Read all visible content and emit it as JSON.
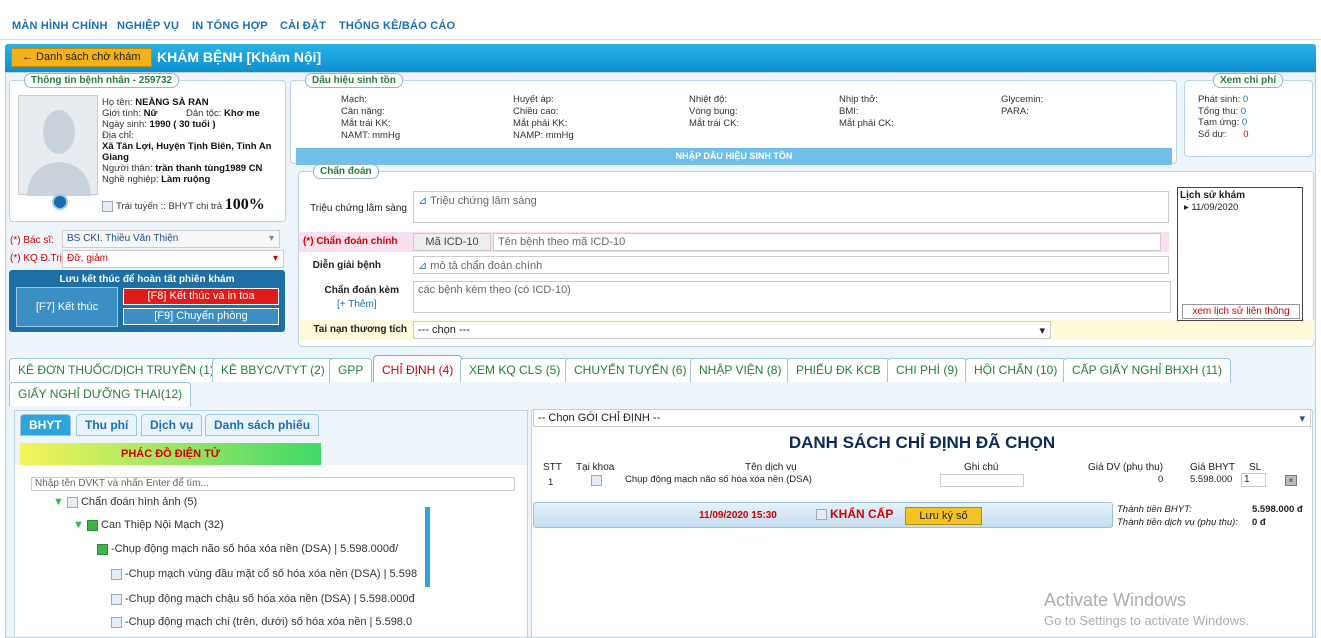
{
  "nav": [
    "MÀN HÌNH CHÍNH",
    "NGHIỆP VỤ",
    "IN TỔNG HỢP",
    "CÀI ĐẶT",
    "THỐNG KÊ/BÁO CÁO"
  ],
  "header": {
    "back": "← Danh sách chờ khám",
    "title": "KHÁM BỆNH [Khám Nội]"
  },
  "patient": {
    "legend": "Thông tin bệnh nhân - 259732",
    "name_label": "Họ tên:",
    "name": "NEÀNG SÀ RAN",
    "gender_label": "Giới tính:",
    "gender": "Nữ",
    "ethnic_label": "Dân tộc:",
    "ethnic": "Khơ me",
    "dob_label": "Ngày sinh:",
    "dob": "1990 ( 30 tuổi )",
    "addr_label": "Địa chỉ:",
    "addr1": "Xã Tân Lợi, Huyện Tịnh Biên, Tỉnh An",
    "addr2": "Giang",
    "rel_label": "Người thân:",
    "rel": "trần thanh tùng1989 CN",
    "job_label": "Nghề nghiệp:",
    "job": "Làm ruộng",
    "bhyt_text": "Trái tuyến :: BHYT chi trả",
    "bhyt_pct": "100%"
  },
  "vitals": {
    "legend": "Dấu hiệu sinh tồn",
    "c1": [
      "Mạch:",
      "Cân nặng:",
      "Mắt trái KK:",
      "NAMT:    mmHg"
    ],
    "c2": [
      "Huyết áp:",
      "Chiều cao:",
      "Mắt phải KK:",
      "NAMP:    mmHg"
    ],
    "c3": [
      "Nhiệt độ:",
      "Vòng bụng:",
      "Mắt trái CK:"
    ],
    "c4": [
      "Nhịp thở:",
      "BMI:",
      "Mắt phải CK:"
    ],
    "c5": [
      "Glycemin:",
      "PARA:"
    ],
    "button": "NHẬP DẤU HIỆU SINH TỒN"
  },
  "cost": {
    "legend": "Xem chi phí",
    "rows": [
      [
        "Phát sinh:",
        "0"
      ],
      [
        "Tổng thu:",
        "0"
      ],
      [
        "Tạm ứng:",
        "0"
      ],
      [
        "Số dư:",
        "0"
      ]
    ]
  },
  "doctor": {
    "label": "(*) Bác sĩ:",
    "value": "BS CKI. Thiều Văn Thiện",
    "kq_label": "(*) KQ Đ.Trị",
    "kq_value": "Đỡ, giảm"
  },
  "finish": {
    "title": "Lưu kết thúc để hoàn tất phiên khám",
    "f7": "[F7] Kết thúc",
    "f8": "[F8] Kết thúc và in toa",
    "f9": "[F9] Chuyển phòng"
  },
  "diag": {
    "legend": "Chẩn đoán",
    "symptom_label": "Triệu chứng lâm sàng",
    "symptom_ph": "Triệu chứng lâm sàng",
    "main_label": "(*) Chẩn đoán chính",
    "icd": "Mã ICD-10",
    "icd_name": "Tên bệnh theo mã ICD-10",
    "explain_label": "Diễn giải bệnh",
    "explain_ph": "mô tả chẩn đoán chính",
    "sub_label": "Chẩn đoán kèm",
    "add": "[+ Thêm]",
    "sub_ph": "các bệnh kèm theo (có ICD-10)",
    "acc_label": "Tai nạn thương tích",
    "acc_value": "--- chọn ---"
  },
  "history": {
    "title": "Lịch sử khám",
    "date": "11/09/2020",
    "link": "xem lịch sử liên thông"
  },
  "tabs": [
    "KÊ ĐƠN THUỐC/DỊCH TRUYỀN (1)",
    "KÊ BBYC/VTYT (2)",
    "GPP",
    "CHỈ ĐỊNH (4)",
    "XEM KQ CLS (5)",
    "CHUYỂN TUYẾN (6)",
    "NHẬP VIỆN (8)",
    "PHIẾU ĐK KCB",
    "CHI PHÍ (9)",
    "HỘI CHẨN (10)",
    "CẤP GIẤY NGHỈ BHXH (11)",
    "GIẤY NGHỈ DƯỠNG THAI(12)"
  ],
  "subtabs": [
    "BHYT",
    "Thu phí",
    "Dịch vụ",
    "Danh sách phiếu"
  ],
  "protocol": "PHÁC ĐỒ ĐIỆN TỬ",
  "search_ph": "Nhập tên DVKT và nhấn Enter để tìm...",
  "tree": {
    "root": "Chẩn đoán hình ảnh (5)",
    "group": "Can Thiệp Nội Mạch (32)",
    "items": [
      "-Chụp động mạch não số hóa xóa nền (DSA) | 5.598.000đ/",
      "-Chụp mạch vùng đầu mặt cổ số hóa xóa nền (DSA) | 5.598",
      "-Chụp động mạch chậu số hóa xóa nền (DSA) | 5.598.000đ",
      "-Chụp động mạch chi (trên, dưới) số hóa xóa nền | 5.598.0"
    ]
  },
  "order": {
    "combo": "-- Chọn GÓI CHỈ ĐỊNH --",
    "title": "DANH SÁCH CHỈ ĐỊNH ĐÃ CHỌN",
    "cols": [
      "STT",
      "Tại khoa",
      "Tên dịch vụ",
      "Ghi chú",
      "Giá DV (phụ thu)",
      "Giá BHYT",
      "SL"
    ],
    "row": {
      "stt": "1",
      "name": "Chụp động mạch não số hóa xóa nền (DSA)",
      "price": "0",
      "bhyt": "5.598.000",
      "qty": "1"
    },
    "datetime": "11/09/2020 15:30",
    "urgent": "KHẨN CẤP",
    "sign": "Lưu ký số",
    "total_bhyt_label": "Thành tiền BHYT:",
    "total_bhyt": "5.598.000 đ",
    "total_dv_label": "Thành tiền dịch vụ (phụ thu):",
    "total_dv": "0 đ"
  },
  "watermark": {
    "line1": "Activate Windows",
    "line2": "Go to Settings to activate Windows."
  }
}
